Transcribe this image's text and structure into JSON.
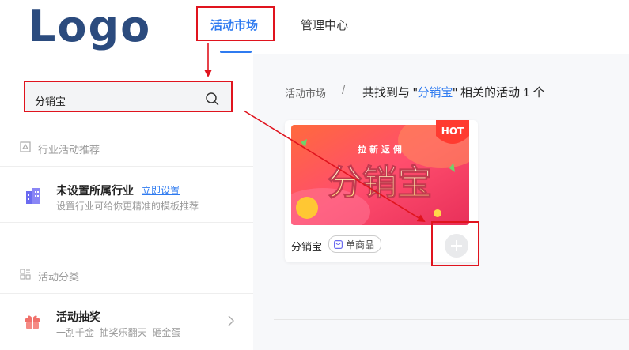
{
  "header": {
    "logo_text": "Logo",
    "tabs": [
      {
        "label": "活动市场",
        "active": true
      },
      {
        "label": "管理中心",
        "active": false
      }
    ]
  },
  "sidebar": {
    "search": {
      "value": "分销宝"
    },
    "industry_section": {
      "title": "行业活动推荐",
      "item_title": "未设置所属行业",
      "item_link": "立即设置",
      "item_desc": "设置行业可给你更精准的模板推荐"
    },
    "category_section": {
      "title": "活动分类",
      "item_title": "活动抽奖",
      "item_desc": "一刮千金  抽奖乐翻天  砸金蛋"
    }
  },
  "main": {
    "breadcrumb_root": "活动市场",
    "breadcrumb_sep": "/",
    "result_prefix": "共找到与 \"",
    "result_keyword": "分销宝",
    "result_suffix": "\" 相关的活动 1 个",
    "card": {
      "name": "分销宝",
      "tag": "单商品",
      "badge": "HOT",
      "banner_subtitle": "拉  新  返  佣",
      "banner_title": "分销宝"
    }
  },
  "colors": {
    "accent": "#2f7bf0",
    "annotation_red": "#e0141e",
    "logo": "#2b4b7e"
  }
}
